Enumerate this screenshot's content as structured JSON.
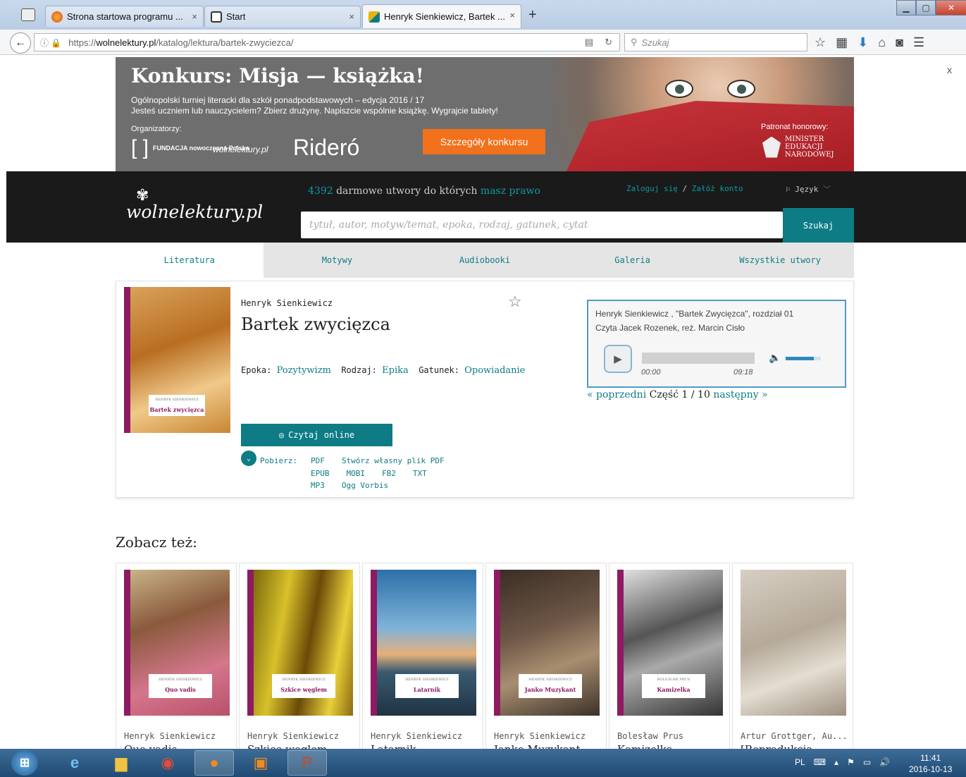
{
  "browser": {
    "tabs": [
      {
        "label": "Strona startowa programu ...",
        "close": "×"
      },
      {
        "label": "Start",
        "close": "×"
      },
      {
        "label": "Henryk Sienkiewicz, Bartek ...",
        "close": "×"
      }
    ],
    "new_tab": "+",
    "url_prefix": "https://",
    "url_host": "wolnelektury.pl",
    "url_path": "/katalog/lektura/bartek-zwyciezca/",
    "search_placeholder": "Szukaj"
  },
  "page": {
    "close_banner": "x",
    "banner": {
      "title": "Konkurs: Misja — książka!",
      "line1": "Ogólnopolski turniej literacki dla szkół ponadpodstawowych – edycja 2016 / 17",
      "line2": "Jesteś uczniem lub nauczycielem? Zbierz drużynę. Napiszcie wspólnie książkę. Wygrajcie tablety!",
      "organizers_label": "Organizatorzy:",
      "org1": "FUNDACJA nowoczesna Polska",
      "org2": "wolnelektury.pl",
      "org3": "Rideró",
      "button": "Szczegóły konkursu",
      "patron_label": "Patronat honorowy:",
      "patron": "MINISTER EDUKACJI NARODOWEJ"
    },
    "header": {
      "logo": "wolnelektury.pl",
      "count": "4392",
      "tagline_mid": " darmowe utwory do których ",
      "tagline_link": "masz prawo",
      "login": "Zaloguj się",
      "sep": " / ",
      "register": "Załóż konto",
      "language": "Język",
      "search_placeholder": "tytuł, autor, motyw/temat, epoka, rodzaj, gatunek, cytat",
      "search_button": "Szukaj"
    },
    "menu": [
      "Literatura",
      "Motywy",
      "Audiobooki",
      "Galeria",
      "Wszystkie utwory"
    ],
    "book": {
      "cover_author": "HENRYK SIENKIEWICZ",
      "cover_title": "Bartek zwycięzca",
      "author": "Henryk Sienkiewicz",
      "title": "Bartek zwycięzca",
      "epoch_label": "Epoka:",
      "epoch": "Pozytywizm",
      "kind_label": "Rodzaj:",
      "kind": "Epika",
      "genre_label": "Gatunek:",
      "genre": "Opowiadanie",
      "read_button": "Czytaj online",
      "download_label": "Pobierz:",
      "downloads": [
        [
          "PDF",
          "Stwórz własny plik PDF"
        ],
        [
          "EPUB",
          "MOBI",
          "FB2",
          "TXT"
        ],
        [
          "MP3",
          "Ogg Vorbis"
        ]
      ]
    },
    "player": {
      "line1": "Henryk Sienkiewicz , \"Bartek Zwycięzca\", rozdział 01",
      "line2": "Czyta Jacek Rozenek, reż. Marcin Cisło",
      "time_current": "00:00",
      "time_total": "09:18",
      "volume_level": 0.8,
      "prev": "« poprzedni",
      "part_label": "Część",
      "part": "1",
      "slash": "/",
      "total_parts": "10",
      "next": "następny »"
    },
    "see_also_heading": "Zobacz też:",
    "related": [
      {
        "author": "Henryk Sienkiewicz",
        "title": "Quo vadis",
        "cover_author": "HENRYK SIENKIEWICZ",
        "cover_title": "Quo vadis"
      },
      {
        "author": "Henryk Sienkiewicz",
        "title": "Szkice węglem",
        "cover_author": "HENRYK SIENKIEWICZ",
        "cover_title": "Szkice węglem"
      },
      {
        "author": "Henryk Sienkiewicz",
        "title": "Latarnik",
        "cover_author": "HENRYK SIENKIEWICZ",
        "cover_title": "Latarnik"
      },
      {
        "author": "Henryk Sienkiewicz",
        "title": "Janko Muzykant",
        "cover_author": "HENRYK SIENKIEWICZ",
        "cover_title": "Janko Muzykant"
      },
      {
        "author": "Bolesław Prus",
        "title": "Kamizelka",
        "cover_author": "BOLESŁAW PRUS",
        "cover_title": "Kamizelka"
      },
      {
        "author": "Artur Grottger, Au...",
        "title": "[Reprodukcja",
        "cover_author": "",
        "cover_title": ""
      }
    ]
  },
  "taskbar": {
    "lang": "PL",
    "time": "11:41",
    "date": "2016-10-13"
  },
  "colors": {
    "accent": "#0d7c84",
    "cover_stripe": "#8e1a62",
    "banner_button": "#f2711c",
    "header_bg": "#1a1a1a"
  }
}
